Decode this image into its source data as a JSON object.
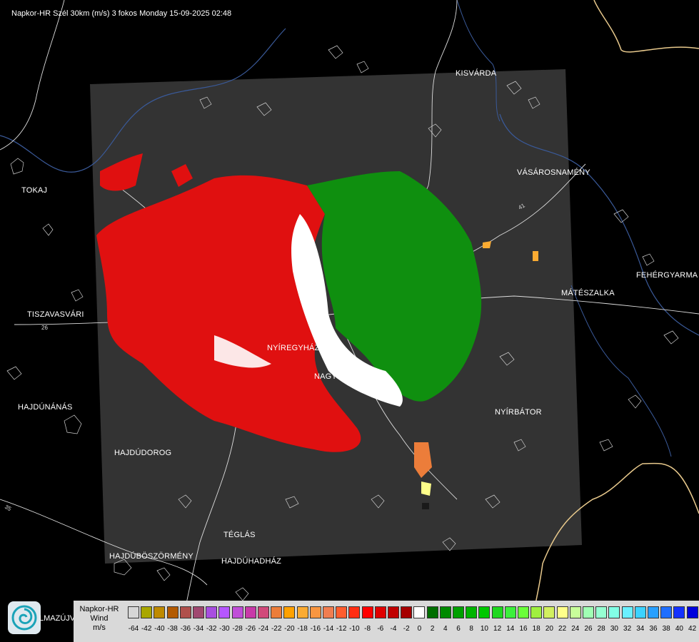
{
  "header": {
    "title": "Napkor-HR Szél 30km (m/s) 3 fokos Monday 15-09-2025 02:48"
  },
  "cities": [
    {
      "id": "kisvarda",
      "name": "KISVÁRDA"
    },
    {
      "id": "tokaj",
      "name": "TOKAJ"
    },
    {
      "id": "vasarosnameny",
      "name": "VÁSÁROSNAMÉNY"
    },
    {
      "id": "fehergyarmat",
      "name": "FEHÉRGYARMA"
    },
    {
      "id": "mateszalka",
      "name": "MÁTÉSZALKA"
    },
    {
      "id": "tiszavasvari",
      "name": "TISZAVASVÁRI"
    },
    {
      "id": "nyiregyhaza",
      "name": "NYÍREGYHÁZA"
    },
    {
      "id": "nagykallo",
      "name": "NAGYKÁLLÓ"
    },
    {
      "id": "hajdunanas",
      "name": "HAJDÚNÁNÁS"
    },
    {
      "id": "nyirbator",
      "name": "NYÍRBÁTOR"
    },
    {
      "id": "hajdudorog",
      "name": "HAJDÚDOROG"
    },
    {
      "id": "teglas",
      "name": "TÉGLÁS"
    },
    {
      "id": "hajduboszormeny",
      "name": "HAJDÚBÖSZÖRMÉNY"
    },
    {
      "id": "hajduhadhaz",
      "name": "HAJDÚHADHÁZ"
    }
  ],
  "road_numbers": [
    "26",
    "35",
    "41"
  ],
  "logo_caption": "LMAZÚJVÁR",
  "legend": {
    "title_lines": [
      "Napkor-HR",
      "Wind",
      "m/s"
    ],
    "ticks": [
      "-64",
      "-42",
      "-40",
      "-38",
      "-36",
      "-34",
      "-32",
      "-30",
      "-28",
      "-26",
      "-24",
      "-22",
      "-20",
      "-18",
      "-16",
      "-14",
      "-12",
      "-10",
      "-8",
      "-6",
      "-4",
      "-2",
      "0",
      "2",
      "4",
      "6",
      "8",
      "10",
      "12",
      "14",
      "16",
      "18",
      "20",
      "22",
      "24",
      "26",
      "28",
      "30",
      "32",
      "34",
      "36",
      "38",
      "40",
      "42"
    ],
    "colors": [
      "#d6d6d6",
      "#a9a700",
      "#bf8a00",
      "#b35a00",
      "#b0504c",
      "#a04870",
      "#a84ee0",
      "#b656ff",
      "#c04ed8",
      "#c83aa8",
      "#d14a7a",
      "#ec7d3a",
      "#ffa100",
      "#fbab32",
      "#f99640",
      "#f07d50",
      "#ff5d2e",
      "#ff2e12",
      "#ff0000",
      "#e00000",
      "#c00000",
      "#a60000",
      "#ffffff",
      "#006e00",
      "#008a00",
      "#00a000",
      "#00b400",
      "#00c800",
      "#1ed81e",
      "#3cf03c",
      "#6aff3a",
      "#a0f040",
      "#d2f060",
      "#ffff8a",
      "#c8ff9a",
      "#a0ffb4",
      "#96ffd2",
      "#82ffe6",
      "#6af0ff",
      "#3cd2ff",
      "#28a0ff",
      "#1e6eff",
      "#1432ff",
      "#0000dc"
    ]
  },
  "colors": {
    "radar_outgoing_red": "#e01010",
    "radar_incoming_green": "#0f8f0f",
    "domain_fill": "#333333",
    "border_line": "#e8c98c",
    "river": "#3a5a9a"
  }
}
